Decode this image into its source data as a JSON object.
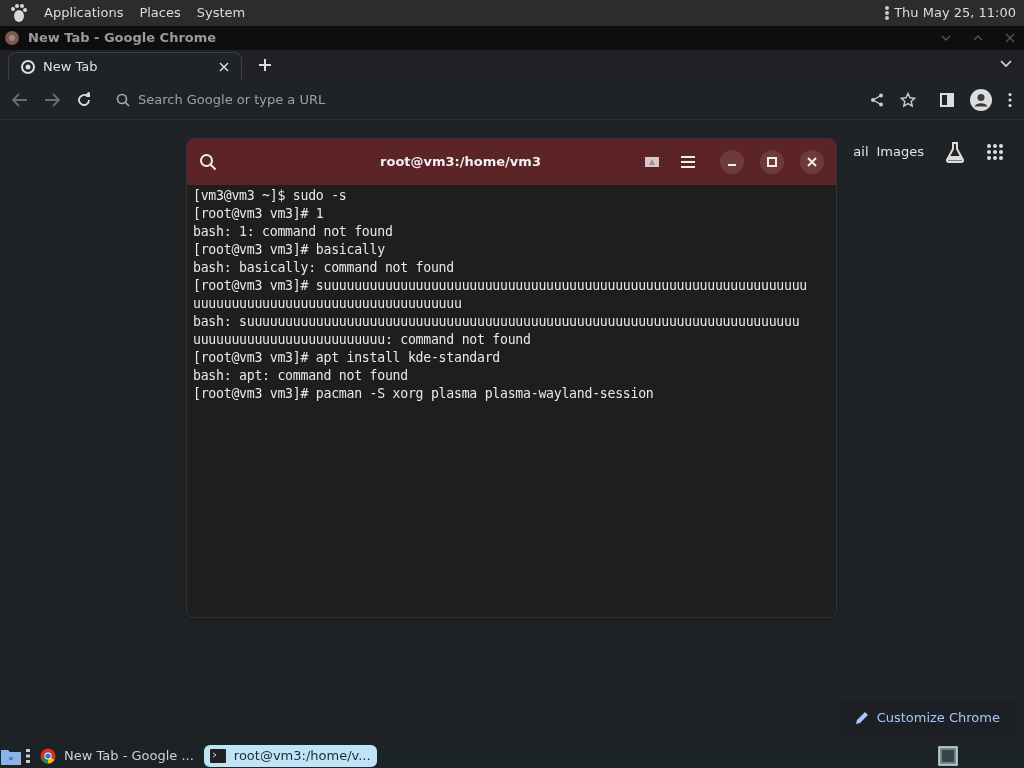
{
  "top_panel": {
    "menus": [
      "Applications",
      "Places",
      "System"
    ],
    "clock": "Thu May 25, 11:00"
  },
  "browser": {
    "title": "New Tab - Google Chrome",
    "tabs": [
      {
        "label": "New Tab",
        "selected": true
      }
    ],
    "omnibox": {
      "placeholder": "Search Google or type a URL"
    },
    "header_links": [
      "ail",
      "Images"
    ],
    "customize_button": "Customize Chrome"
  },
  "terminal": {
    "title": "root@vm3:/home/vm3",
    "lines": [
      "[vm3@vm3 ~]$ sudo -s",
      "[root@vm3 vm3]# 1",
      "bash: 1: command not found",
      "[root@vm3 vm3]# basically",
      "bash: basically: command not found",
      "[root@vm3 vm3]# suuuuuuuuuuuuuuuuuuuuuuuuuuuuuuuuuuuuuuuuuuuuuuuuuuuuuuuuuuuuuuu",
      "uuuuuuuuuuuuuuuuuuuuuuuuuuuuuuuuuuu",
      "bash: suuuuuuuuuuuuuuuuuuuuuuuuuuuuuuuuuuuuuuuuuuuuuuuuuuuuuuuuuuuuuuuuuuuuuuuu",
      "uuuuuuuuuuuuuuuuuuuuuuuuu: command not found",
      "[root@vm3 vm3]# apt install kde-standard",
      "bash: apt: command not found",
      "[root@vm3 vm3]# pacman -S xorg plasma plasma-wayland-session"
    ]
  },
  "taskbar": {
    "windows": [
      {
        "label": "New Tab - Google ...",
        "kind": "browser",
        "selected": false
      },
      {
        "label": "root@vm3:/home/v...",
        "kind": "terminal",
        "selected": true
      }
    ]
  }
}
